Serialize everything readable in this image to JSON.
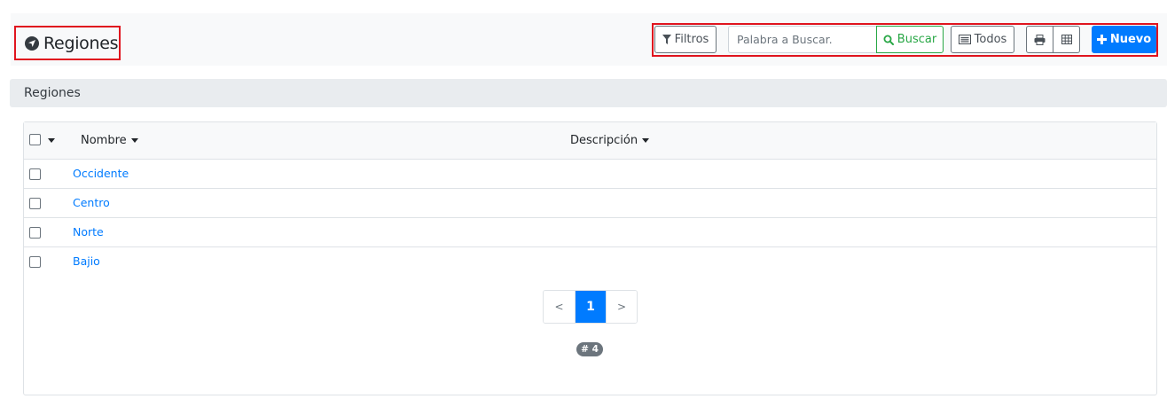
{
  "header": {
    "title": "Regiones",
    "title_icon": "location-arrow-icon"
  },
  "toolbar": {
    "filters_label": "Filtros",
    "search_placeholder": "Palabra a Buscar.",
    "search_value": "",
    "search_button_label": "Buscar",
    "all_label": "Todos",
    "print_icon": "print-icon",
    "grid_icon": "table-icon",
    "new_label": "Nuevo"
  },
  "section": {
    "title": "Regiones"
  },
  "table": {
    "columns": [
      "Nombre",
      "Descripción"
    ],
    "rows": [
      {
        "nombre": "Occidente",
        "descripcion": ""
      },
      {
        "nombre": "Centro",
        "descripcion": ""
      },
      {
        "nombre": "Norte",
        "descripcion": ""
      },
      {
        "nombre": "Bajio",
        "descripcion": ""
      }
    ]
  },
  "pagination": {
    "prev": "<",
    "current": "1",
    "next": ">"
  },
  "count_badge": "# 4",
  "colors": {
    "primary": "#007bff",
    "success": "#28a745",
    "highlight_border": "#e0141e",
    "secondary": "#6c757d"
  }
}
